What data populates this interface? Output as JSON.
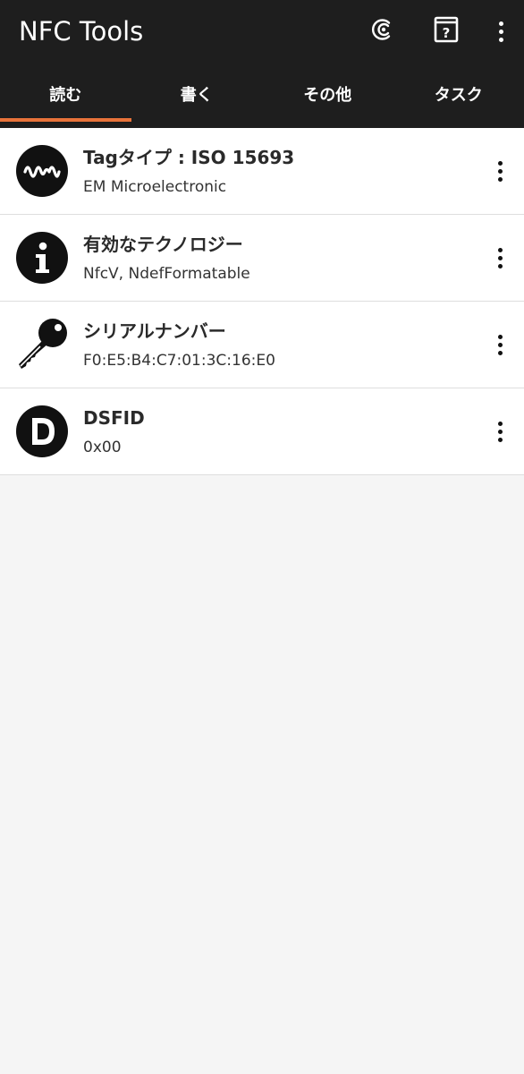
{
  "appbar": {
    "title": "NFC Tools",
    "actions": [
      {
        "icon": "nfc-c-icon"
      },
      {
        "icon": "help-book-icon"
      },
      {
        "icon": "more-vert-icon"
      }
    ]
  },
  "tabs": [
    {
      "label": "読む",
      "active": true
    },
    {
      "label": "書く",
      "active": false
    },
    {
      "label": "その他",
      "active": false
    },
    {
      "label": "タスク",
      "active": false
    }
  ],
  "items": [
    {
      "icon": "waveform-icon",
      "title": "Tagタイプ : ISO 15693",
      "subtitle": "EM Microelectronic"
    },
    {
      "icon": "info-icon",
      "title": "有効なテクノロジー",
      "subtitle": "NfcV, NdefFormatable"
    },
    {
      "icon": "key-icon",
      "title": "シリアルナンバー",
      "subtitle": "F0:E5:B4:C7:01:3C:16:E0"
    },
    {
      "icon": "d-letter-icon",
      "title": "DSFID",
      "subtitle": "0x00"
    }
  ],
  "colors": {
    "appbar_bg": "#1e1e1e",
    "tab_indicator": "#e8733a",
    "page_bg": "#f5f5f5"
  }
}
